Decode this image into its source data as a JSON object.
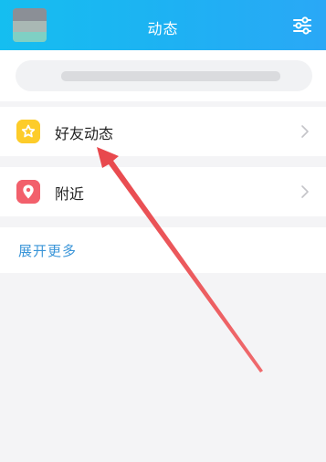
{
  "header": {
    "title": "动态",
    "icons": {
      "avatar": "avatar",
      "filter": "sliders-icon"
    }
  },
  "search": {
    "placeholder": ""
  },
  "list": {
    "items": [
      {
        "label": "好友动态",
        "icon": "star-badge-icon",
        "icon_color": "#fdcc2a"
      },
      {
        "label": "附近",
        "icon": "location-pin-icon",
        "icon_color": "#f2606c"
      }
    ],
    "more": "展开更多"
  },
  "colors": {
    "header_bg": "#1eb1f3",
    "link": "#3a95d8",
    "annotation_arrow": "#e8474c"
  }
}
